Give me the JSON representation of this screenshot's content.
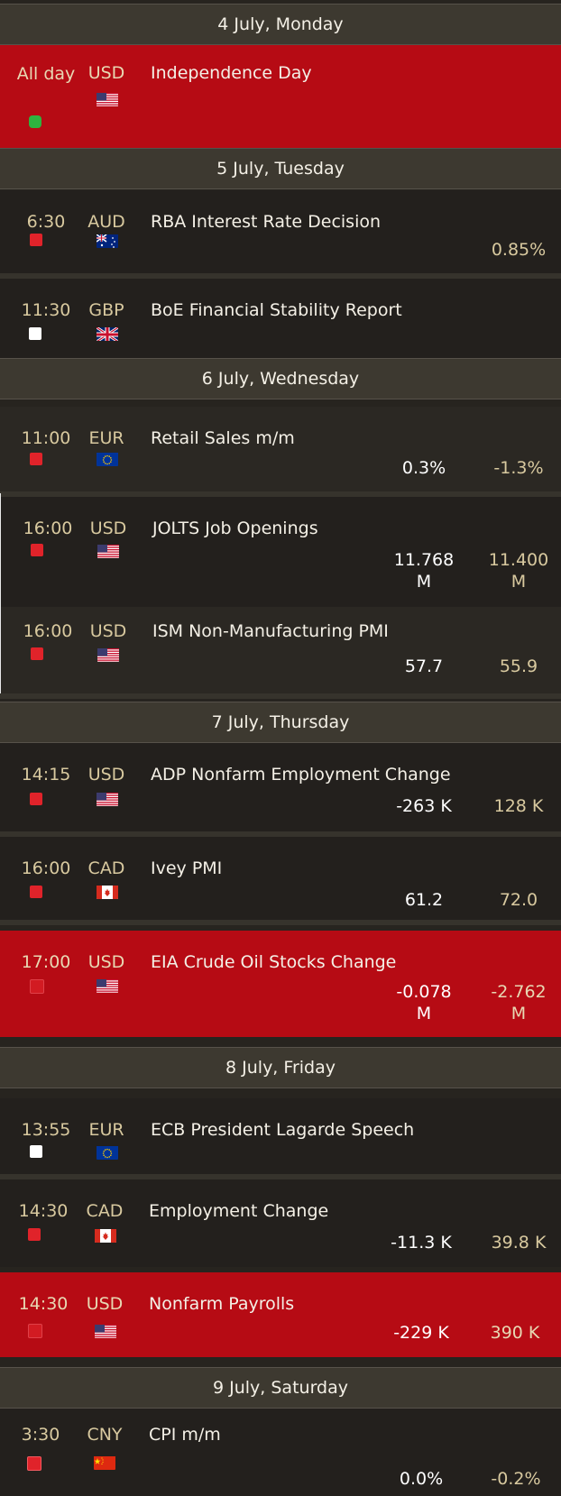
{
  "colors": {
    "background": "#27241f",
    "day_header": "#3d3930",
    "high_impact_row": "#b60b14",
    "impact_red": "#e0232a",
    "impact_white": "#ffffff",
    "impact_green": "#2eb33f"
  },
  "days": [
    {
      "label": "4 July, Monday"
    },
    {
      "label": "5 July, Tuesday"
    },
    {
      "label": "6 July, Wednesday"
    },
    {
      "label": "7 July, Thursday"
    },
    {
      "label": "8 July, Friday"
    },
    {
      "label": "9 July, Saturday"
    }
  ],
  "events": [
    {
      "time": "All day",
      "currency": "USD",
      "name": "Independence Day",
      "impact": "green",
      "flag": "us-flag-icon",
      "actual": "",
      "previous": ""
    },
    {
      "time": "6:30",
      "currency": "AUD",
      "name": "RBA Interest Rate Decision",
      "impact": "red",
      "flag": "au-flag-icon",
      "actual": "",
      "previous": "0.85%"
    },
    {
      "time": "11:30",
      "currency": "GBP",
      "name": "BoE Financial Stability Report",
      "impact": "white",
      "flag": "gb-flag-icon",
      "actual": "",
      "previous": ""
    },
    {
      "time": "11:00",
      "currency": "EUR",
      "name": "Retail Sales m/m",
      "impact": "red",
      "flag": "eu-flag-icon",
      "actual": "0.3%",
      "previous": "-1.3%"
    },
    {
      "time": "16:00",
      "currency": "USD",
      "name": "JOLTS Job Openings",
      "impact": "red",
      "flag": "us-flag-icon",
      "actual_line1": "11.768",
      "actual_line2": "M",
      "previous_line1": "11.400",
      "previous_line2": "M"
    },
    {
      "time": "16:00",
      "currency": "USD",
      "name": "ISM Non-Manufacturing PMI",
      "impact": "red",
      "flag": "us-flag-icon",
      "actual": "57.7",
      "previous": "55.9"
    },
    {
      "time": "14:15",
      "currency": "USD",
      "name": "ADP Nonfarm Employment Change",
      "impact": "red",
      "flag": "us-flag-icon",
      "actual": "-263 K",
      "previous": "128 K"
    },
    {
      "time": "16:00",
      "currency": "CAD",
      "name": "Ivey PMI",
      "impact": "red",
      "flag": "ca-flag-icon",
      "actual": "61.2",
      "previous": "72.0"
    },
    {
      "time": "17:00",
      "currency": "USD",
      "name": "EIA Crude Oil Stocks Change",
      "impact": "red",
      "flag": "us-flag-icon",
      "actual_line1": "-0.078",
      "actual_line2": "M",
      "previous_line1": "-2.762",
      "previous_line2": "M"
    },
    {
      "time": "13:55",
      "currency": "EUR",
      "name": "ECB President Lagarde Speech",
      "impact": "white",
      "flag": "eu-flag-icon",
      "actual": "",
      "previous": ""
    },
    {
      "time": "14:30",
      "currency": "CAD",
      "name": "Employment Change",
      "impact": "red",
      "flag": "ca-flag-icon",
      "actual": "-11.3 K",
      "previous": "39.8 K"
    },
    {
      "time": "14:30",
      "currency": "USD",
      "name": "Nonfarm Payrolls",
      "impact": "red",
      "flag": "us-flag-icon",
      "actual": "-229 K",
      "previous": "390 K"
    },
    {
      "time": "3:30",
      "currency": "CNY",
      "name": "CPI m/m",
      "impact": "red",
      "flag": "cn-flag-icon",
      "actual": "0.0%",
      "previous": "-0.2%"
    }
  ]
}
